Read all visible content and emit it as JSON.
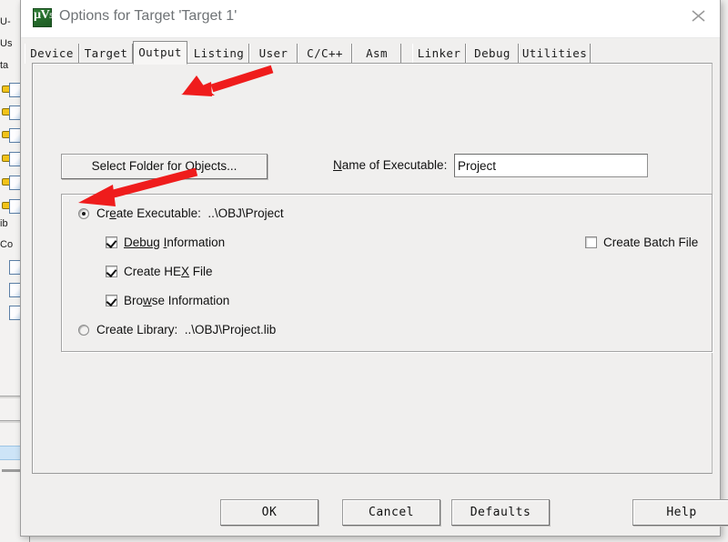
{
  "background_window": {
    "name": "keil-uvision-project-pane",
    "text_fragments": [
      "U-",
      "Us",
      "ta",
      "ib",
      "Co"
    ]
  },
  "dialog": {
    "title": "Options for Target 'Target 1'",
    "app_icon": "uvision-logo-icon",
    "close_icon": "close-icon",
    "title_color": "#6f7376",
    "tabs": [
      {
        "label": "Device",
        "selected": false
      },
      {
        "label": "Target",
        "selected": false
      },
      {
        "label": "Output",
        "selected": true
      },
      {
        "label": "Listing",
        "selected": false
      },
      {
        "label": "User",
        "selected": false
      },
      {
        "label": "C/C++",
        "selected": false
      },
      {
        "label": "Asm",
        "selected": false
      },
      {
        "label": "Linker",
        "selected": false
      },
      {
        "label": "Debug",
        "selected": false
      },
      {
        "label": "Utilities",
        "selected": false
      }
    ],
    "output_page": {
      "select_folder_button": "Select Folder for Objects...",
      "select_folder_mnemonic": "O",
      "name_of_executable_label": "Name of Executable:",
      "name_of_executable_mnemonic": "N",
      "executable_name_value": "Project",
      "executable_name_placeholder": "",
      "create_executable": {
        "label": "Create Executable:",
        "path": "..\\OBJ\\Project",
        "checked": true
      },
      "checkboxes": [
        {
          "label_pre": "D",
          "label_mid": "ebug",
          "label_post": " Information",
          "label": "Debug Information",
          "checked": true
        },
        {
          "label_pre": "",
          "label_mid": "",
          "label_post": "",
          "label": "Create HEX File",
          "checked": true
        },
        {
          "label_pre": "",
          "label_mid": "",
          "label_post": "",
          "label": "Browse Information",
          "checked": true
        }
      ],
      "create_batch_file": {
        "label": "Create Batch File",
        "checked": false
      },
      "create_library": {
        "label": "Create Library:",
        "path": "..\\OBJ\\Project.lib",
        "checked": false
      }
    },
    "footer_buttons": [
      {
        "label": "OK"
      },
      {
        "label": "Cancel"
      },
      {
        "label": "Defaults"
      },
      {
        "label": "Help"
      }
    ]
  },
  "annotations": {
    "arrow_color": "#ef1c1c",
    "arrows": [
      {
        "name": "arrow-to-select-folder-button",
        "target": "Select Folder for Objects..."
      },
      {
        "name": "arrow-to-create-hex-file-checkbox",
        "target": "Create HEX File"
      }
    ]
  }
}
